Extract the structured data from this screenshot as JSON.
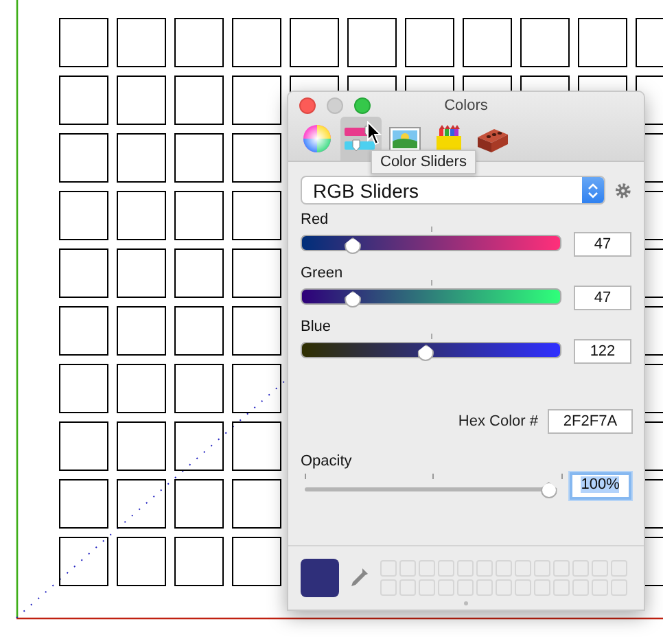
{
  "window": {
    "title": "Colors"
  },
  "tabs": [
    {
      "kind": "wheel",
      "selected": false
    },
    {
      "kind": "sliders",
      "selected": true
    },
    {
      "kind": "image",
      "selected": false
    },
    {
      "kind": "pencils",
      "selected": false
    },
    {
      "kind": "brick",
      "selected": false
    }
  ],
  "tooltip": "Color Sliders",
  "mode": {
    "value": "RGB Sliders"
  },
  "channels": [
    {
      "name": "Red",
      "level": 0.18,
      "reading": "47"
    },
    {
      "name": "Green",
      "level": 0.18,
      "reading": "47"
    },
    {
      "name": "Blue",
      "level": 0.48,
      "reading": "122"
    }
  ],
  "hex": {
    "label": "Hex Color #",
    "value": "2F2F7A"
  },
  "opacity": {
    "label": "Opacity",
    "level": 1,
    "value": "100%"
  }
}
